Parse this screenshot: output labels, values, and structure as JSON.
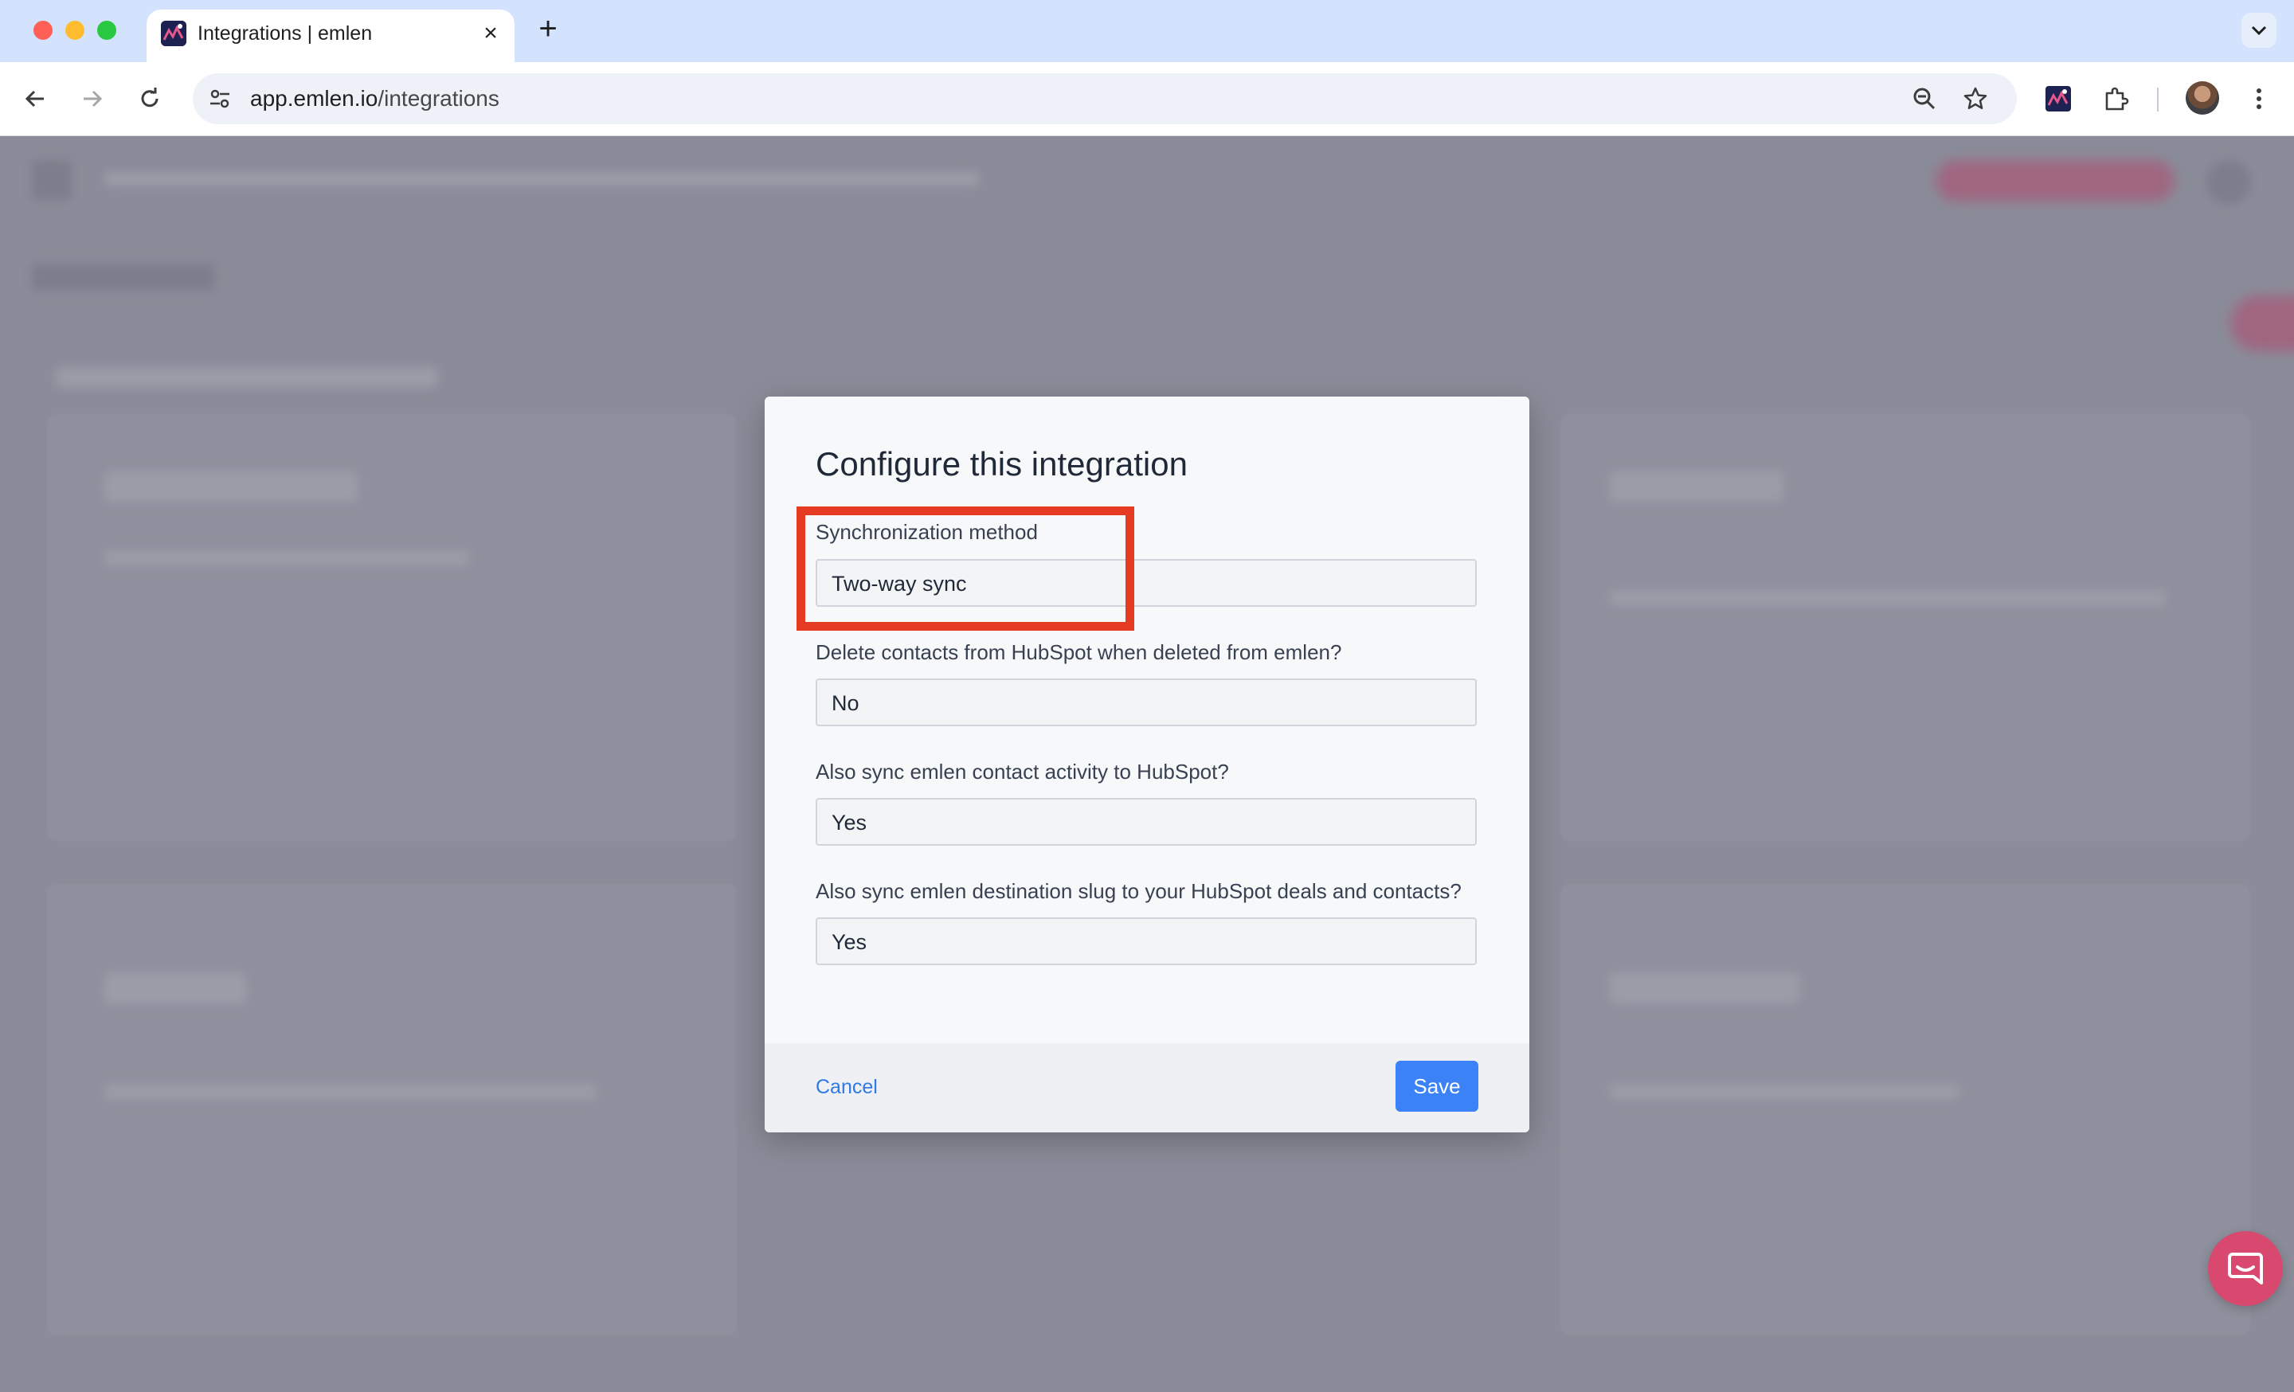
{
  "browser": {
    "tab_title": "Integrations | emlen",
    "url_host": "app.emlen.io",
    "url_path": "/integrations"
  },
  "modal": {
    "title": "Configure this integration",
    "fields": [
      {
        "label": "Synchronization method",
        "value": "Two-way sync"
      },
      {
        "label": "Delete contacts from HubSpot when deleted from emlen?",
        "value": "No"
      },
      {
        "label": "Also sync emlen contact activity to HubSpot?",
        "value": "Yes"
      },
      {
        "label": "Also sync emlen destination slug to your HubSpot deals and contacts?",
        "value": "Yes"
      }
    ],
    "cancel_label": "Cancel",
    "save_label": "Save"
  },
  "icons": {
    "back": "arrow-left-icon",
    "forward": "arrow-right-icon",
    "reload": "reload-icon",
    "site_info": "tune-icon",
    "zoom": "zoom-out-icon",
    "bookmark": "star-icon",
    "extension_emlen": "emlen-extension-icon",
    "extensions": "puzzle-icon",
    "menu": "kebab-menu-icon",
    "chat": "chat-bubble-icon"
  },
  "colors": {
    "accent": "#3b82f6",
    "highlight": "#e53b23",
    "chat": "#d9486f"
  }
}
